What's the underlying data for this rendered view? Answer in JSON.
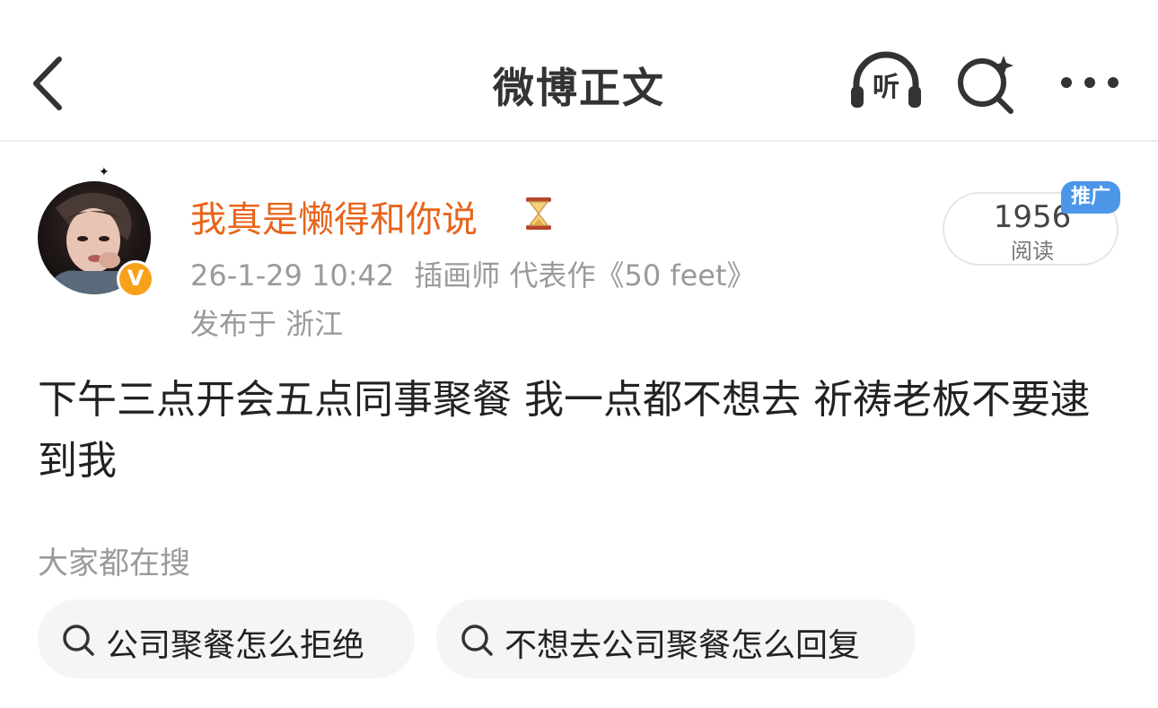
{
  "header": {
    "title": "微博正文",
    "listen_label": "听"
  },
  "post": {
    "author": {
      "name": "我真是懒得和你说",
      "name_emoji": "hourglass-icon",
      "verified_badge": "V"
    },
    "timestamp": "26-1-29 10:42",
    "author_title": "插画师 代表作《50 feet》",
    "location": "发布于 浙江",
    "read_count": "1956",
    "read_label": "阅读",
    "promo_badge": "推广",
    "content": "下午三点开会五点同事聚餐 我一点都不想去 祈祷老板不要逮到我"
  },
  "related_search": {
    "title": "大家都在搜",
    "items": [
      {
        "label": "公司聚餐怎么拒绝"
      },
      {
        "label": "不想去公司聚餐怎么回复"
      }
    ]
  },
  "colors": {
    "username": "#e8641a",
    "meta_gray": "#9a9a9a",
    "promo_blue": "#4c96e8",
    "verified_gold": "#f7a11a"
  }
}
